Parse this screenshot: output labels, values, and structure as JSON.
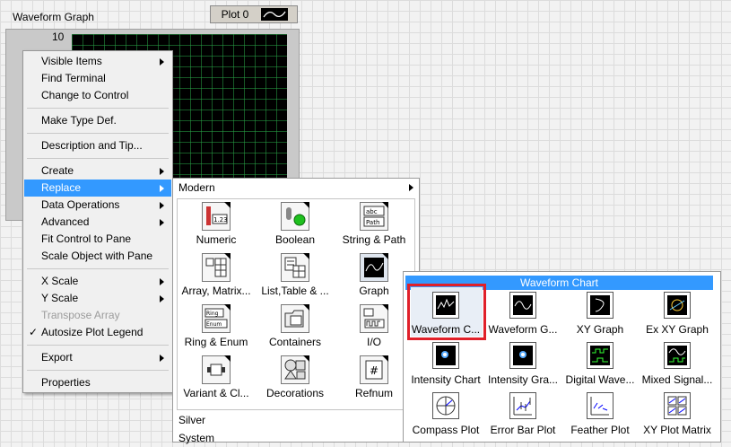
{
  "graph": {
    "label": "Waveform Graph",
    "legend_plot_name": "Plot 0",
    "y_top_tick": "10"
  },
  "context_menu": {
    "items": [
      {
        "label": "Visible Items",
        "submenu": true
      },
      {
        "label": "Find Terminal"
      },
      {
        "label": "Change to Control"
      },
      {
        "label": "Make Type Def."
      },
      {
        "label": "Description and Tip..."
      },
      {
        "label": "Create",
        "submenu": true
      },
      {
        "label": "Replace",
        "submenu": true,
        "highlighted": true
      },
      {
        "label": "Data Operations",
        "submenu": true
      },
      {
        "label": "Advanced",
        "submenu": true
      },
      {
        "label": "Fit Control to Pane"
      },
      {
        "label": "Scale Object with Pane"
      },
      {
        "label": "X Scale",
        "submenu": true
      },
      {
        "label": "Y Scale",
        "submenu": true
      },
      {
        "label": "Transpose Array",
        "disabled": true
      },
      {
        "label": "Autosize Plot Legend",
        "checked": true
      },
      {
        "label": "Export",
        "submenu": true
      },
      {
        "label": "Properties"
      }
    ],
    "check_glyph": "✓"
  },
  "palette": {
    "header": "Modern",
    "items": [
      {
        "label": "Numeric",
        "icon": "numeric-icon"
      },
      {
        "label": "Boolean",
        "icon": "boolean-icon"
      },
      {
        "label": "String & Path",
        "icon": "string-path-icon"
      },
      {
        "label": "Array, Matrix...",
        "icon": "array-matrix-icon"
      },
      {
        "label": "List,Table & ...",
        "icon": "list-table-icon"
      },
      {
        "label": "Graph",
        "icon": "graph-icon"
      },
      {
        "label": "Ring & Enum",
        "icon": "ring-enum-icon"
      },
      {
        "label": "Containers",
        "icon": "containers-icon"
      },
      {
        "label": "I/O",
        "icon": "io-icon"
      },
      {
        "label": "Variant & Cl...",
        "icon": "variant-class-icon"
      },
      {
        "label": "Decorations",
        "icon": "decorations-icon"
      },
      {
        "label": "Refnum",
        "icon": "refnum-icon"
      }
    ],
    "icon_text": {
      "numeric": "1.23",
      "string_top": "abc",
      "string_bottom": "Path",
      "ring": "Ring",
      "enum": "Enum",
      "refnum": "#"
    },
    "sub_items": [
      "Silver",
      "System"
    ]
  },
  "graph_palette": {
    "header": "Waveform Chart",
    "items": [
      {
        "label": "Waveform C...",
        "icon": "waveform-chart-icon",
        "selected": true
      },
      {
        "label": "Waveform G...",
        "icon": "waveform-graph-icon"
      },
      {
        "label": "XY Graph",
        "icon": "xy-graph-icon"
      },
      {
        "label": "Ex XY Graph",
        "icon": "ex-xy-graph-icon"
      },
      {
        "label": "Intensity Chart",
        "icon": "intensity-chart-icon"
      },
      {
        "label": "Intensity Gra...",
        "icon": "intensity-graph-icon"
      },
      {
        "label": "Digital Wave...",
        "icon": "digital-waveform-icon"
      },
      {
        "label": "Mixed Signal...",
        "icon": "mixed-signal-icon"
      },
      {
        "label": "Compass Plot",
        "icon": "compass-plot-icon"
      },
      {
        "label": "Error Bar Plot",
        "icon": "error-bar-plot-icon"
      },
      {
        "label": "Feather Plot",
        "icon": "feather-plot-icon"
      },
      {
        "label": "XY Plot Matrix",
        "icon": "xy-plot-matrix-icon"
      }
    ]
  },
  "colors": {
    "menu_highlight": "#3399ff",
    "selection_outline": "#e0202a",
    "plot_background": "#000000",
    "grid_lines": "#28a046"
  }
}
